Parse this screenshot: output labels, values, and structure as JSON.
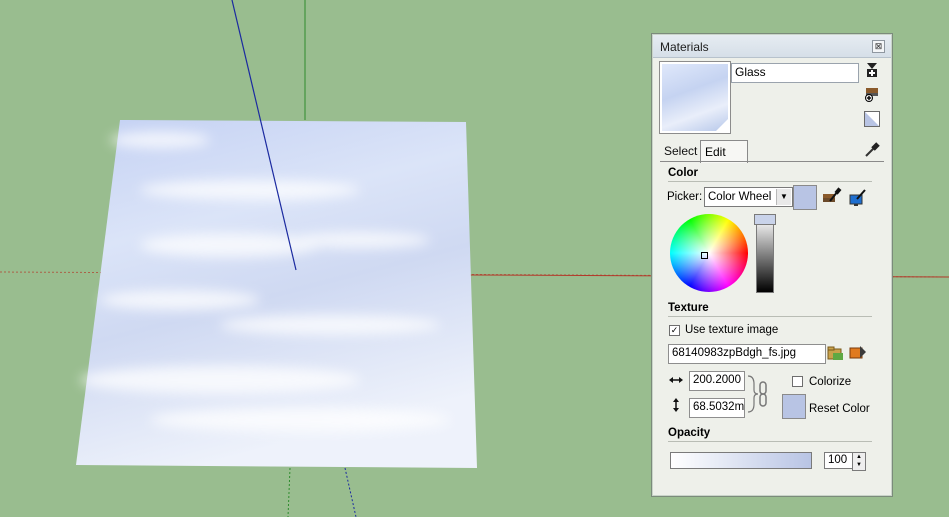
{
  "materials_panel": {
    "title": "Materials",
    "close_glyph": "⊠",
    "material_name": "Glass",
    "tabs": [
      "Select",
      "Edit"
    ],
    "color_section": {
      "title": "Color",
      "picker_label": "Picker:",
      "picker_value": "Color Wheel",
      "swatch_color": "#b8c4e4"
    },
    "texture_section": {
      "title": "Texture",
      "use_texture_label": "Use texture image",
      "use_texture_checked": true,
      "filename": "68140983zpBdgh_fs.jpg",
      "width_value": "200.2000",
      "height_value": "68.5032m",
      "colorize_label": "Colorize",
      "colorize_checked": false,
      "reset_color_label": "Reset Color"
    },
    "opacity_section": {
      "title": "Opacity",
      "value": "100"
    }
  },
  "colors": {
    "background": "#99bd8f",
    "axis_red": "#b23a2a",
    "axis_green": "#2e8b2e",
    "axis_blue": "#1b2aa0"
  }
}
